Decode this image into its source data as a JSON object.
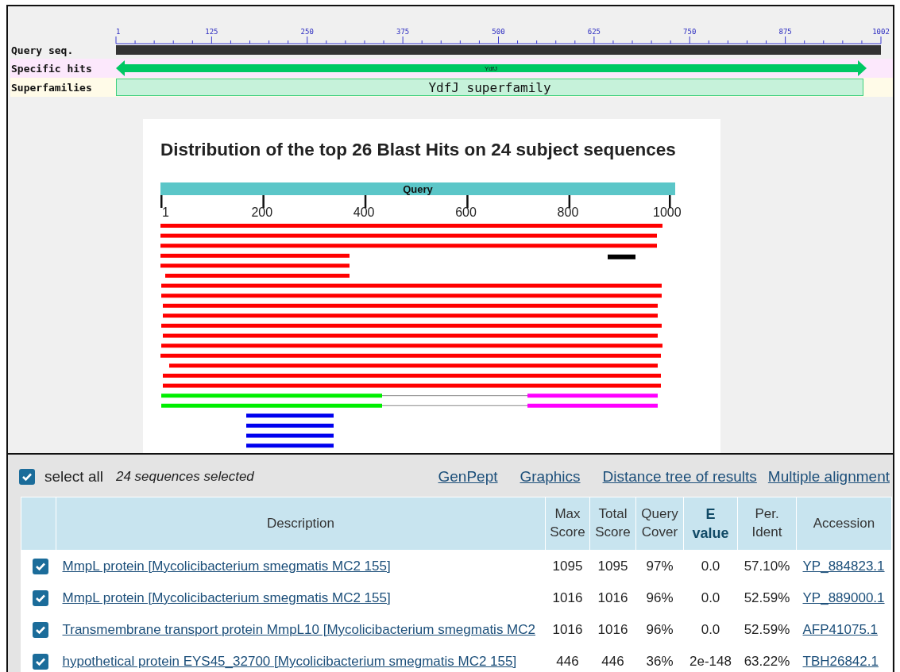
{
  "domain_view": {
    "ruler_ticks": [
      "1",
      "125",
      "250",
      "375",
      "500",
      "625",
      "750",
      "875",
      "1002"
    ],
    "rows": [
      {
        "kind": "query",
        "label": "Query seq."
      },
      {
        "kind": "hit",
        "label": "Specific hits",
        "name": "YdfJ"
      },
      {
        "kind": "superfamily",
        "label": "Superfamilies",
        "name": "YdfJ superfamily"
      }
    ]
  },
  "distribution": {
    "title": "Distribution of the top 26 Blast Hits on 24 subject sequences",
    "query_label": "Query",
    "axis_ticks": [
      "1",
      "200",
      "400",
      "600",
      "800",
      "1000"
    ]
  },
  "selection": {
    "checked": true,
    "label": "select all",
    "summary": "24 sequences selected",
    "links": [
      "GenPept",
      "Graphics",
      "Distance tree of results",
      "Multiple alignment"
    ]
  },
  "table": {
    "columns": [
      {
        "label": "Description",
        "kind": "link",
        "sorted": false
      },
      {
        "label": "Max Score",
        "kind": "text",
        "sorted": false
      },
      {
        "label": "Total Score",
        "kind": "text",
        "sorted": false
      },
      {
        "label": "Query Cover",
        "kind": "text",
        "sorted": false
      },
      {
        "label": "E value",
        "kind": "text",
        "sorted": true
      },
      {
        "label": "Per. Ident",
        "kind": "text",
        "sorted": false
      },
      {
        "label": "Accession",
        "kind": "link",
        "sorted": false
      }
    ],
    "rows": [
      {
        "checked": true,
        "cells": [
          "MmpL protein [Mycolicibacterium smegmatis MC2 155]",
          "1095",
          "1095",
          "97%",
          "0.0",
          "57.10%",
          "YP_884823.1"
        ]
      },
      {
        "checked": true,
        "cells": [
          "MmpL protein [Mycolicibacterium smegmatis MC2 155]",
          "1016",
          "1016",
          "96%",
          "0.0",
          "52.59%",
          "YP_889000.1"
        ]
      },
      {
        "checked": true,
        "cells": [
          "Transmembrane transport protein MmpL10 [Mycolicibacterium smegmatis MC2",
          "1016",
          "1016",
          "96%",
          "0.0",
          "52.59%",
          "AFP41075.1"
        ]
      },
      {
        "checked": true,
        "cells": [
          "hypothetical protein EYS45_32700 [Mycolicibacterium smegmatis MC2 155]",
          "446",
          "446",
          "36%",
          "2e-148",
          "63.22%",
          "TBH26842.1"
        ]
      }
    ]
  }
}
